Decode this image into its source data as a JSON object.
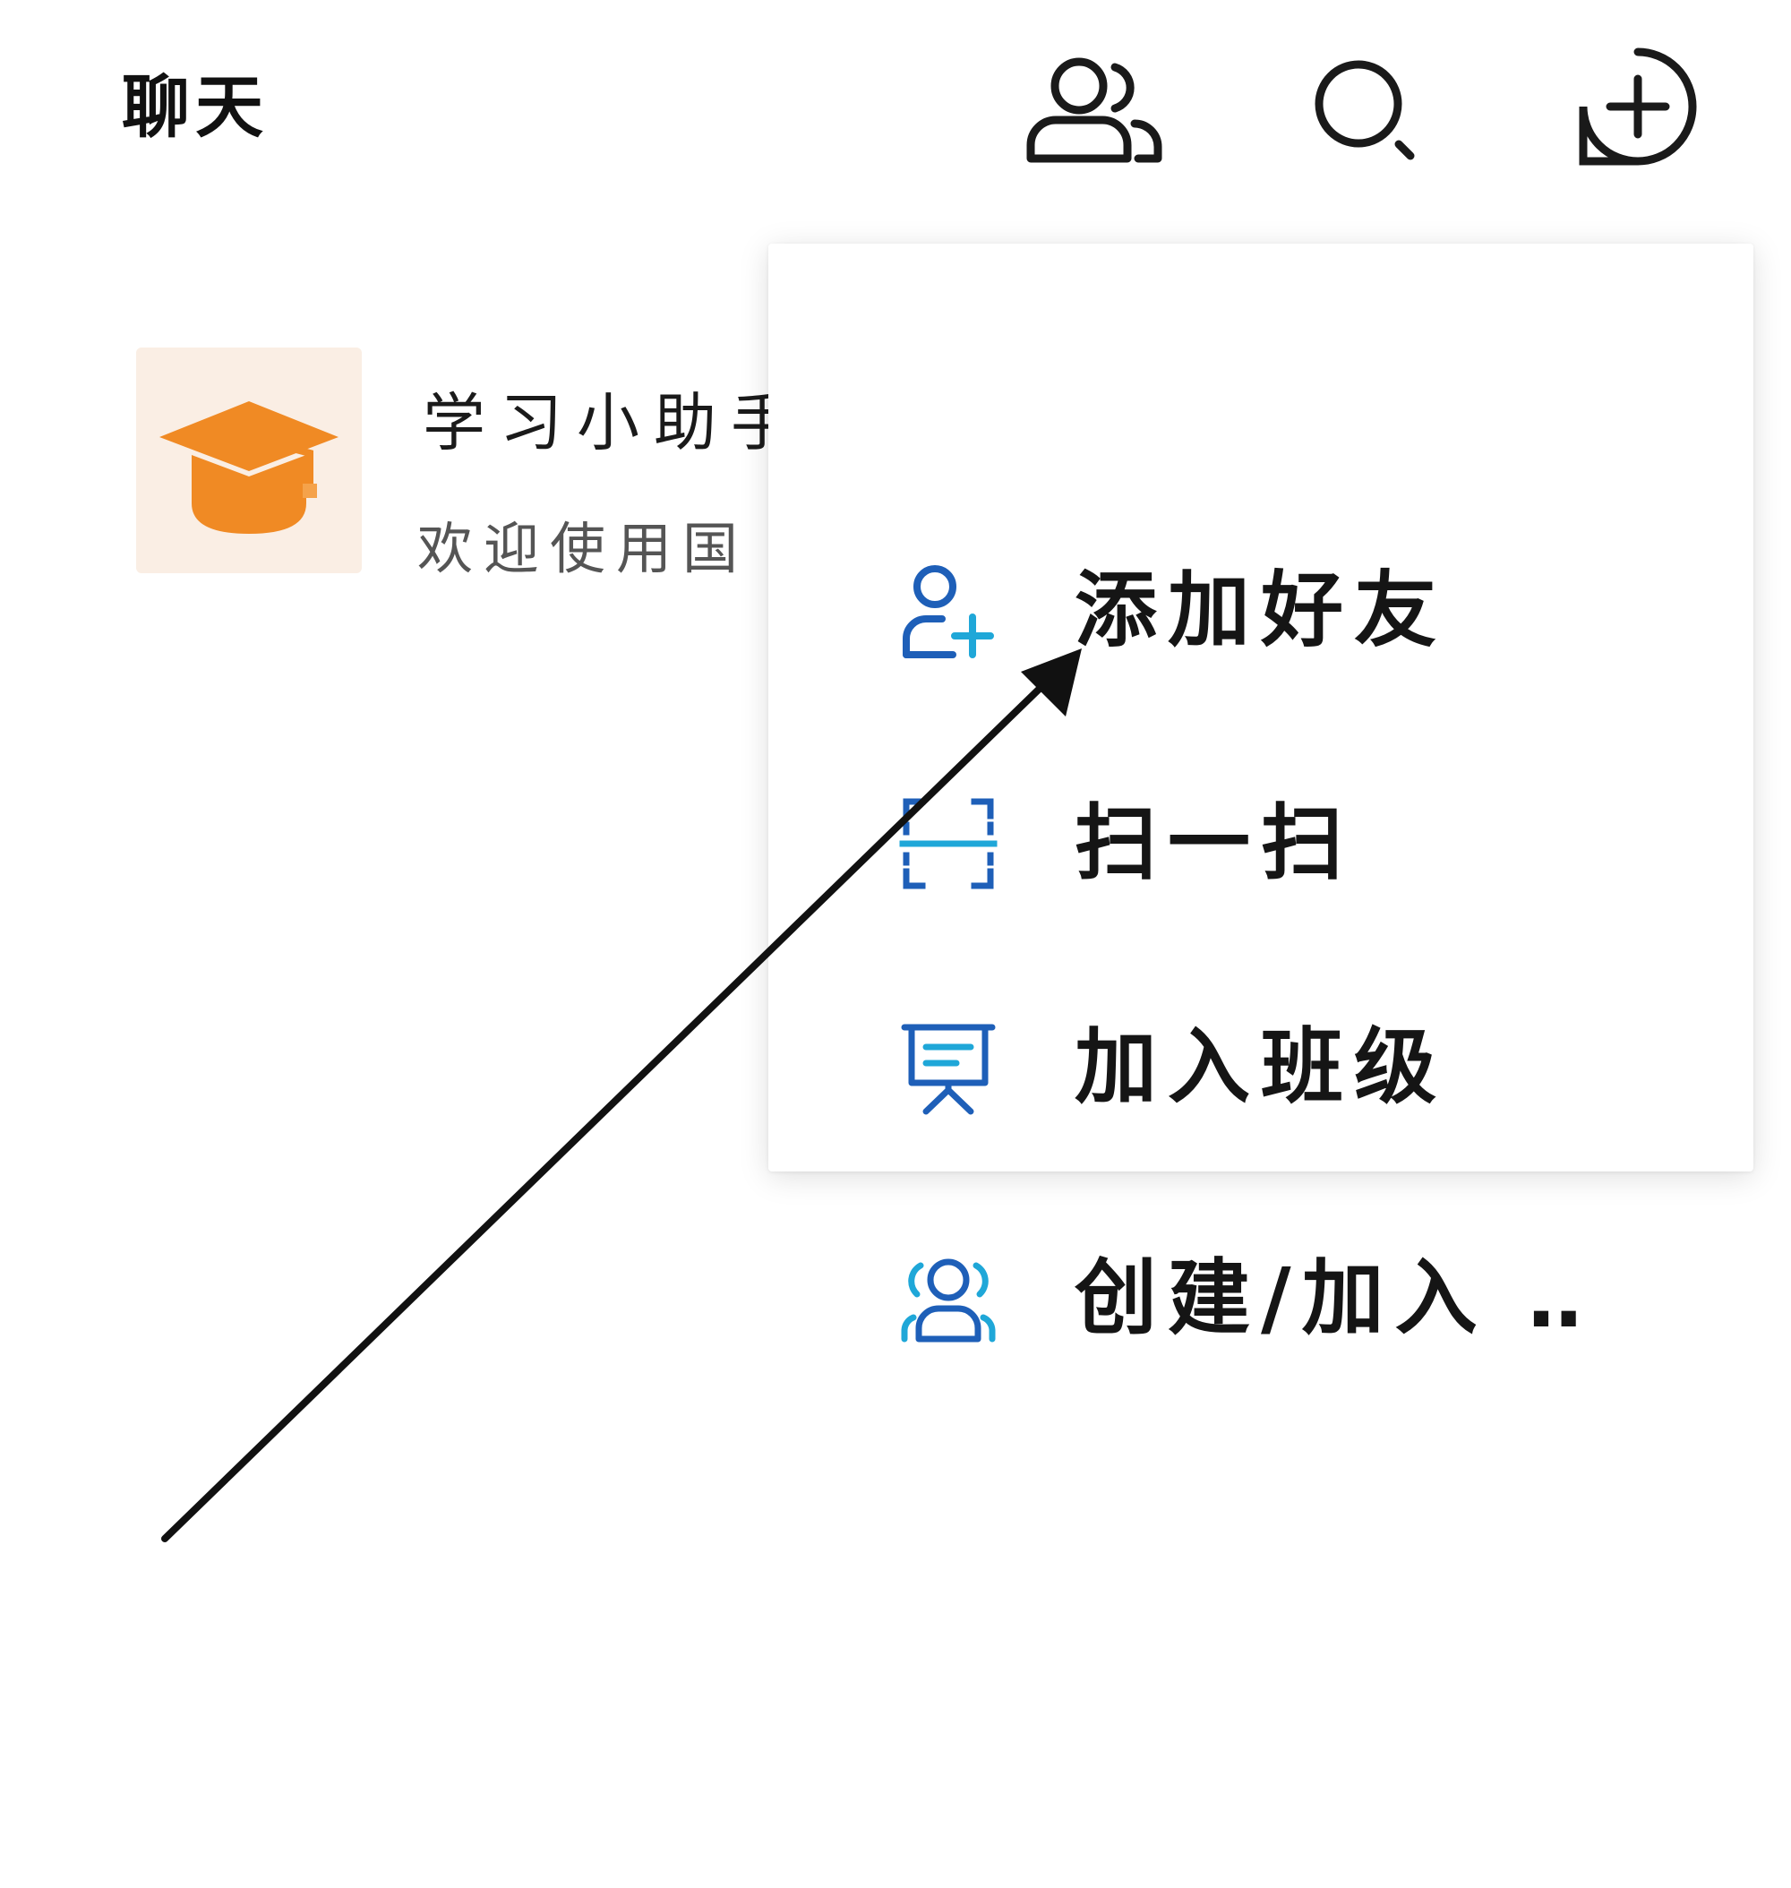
{
  "header": {
    "title": "聊天",
    "icons": [
      "contacts-icon",
      "search-icon",
      "add-icon"
    ]
  },
  "chat_list": [
    {
      "name": "学习小助手",
      "preview": "欢迎使用国",
      "avatar_icon": "graduation-cap-icon",
      "avatar_color": "#F08A24"
    }
  ],
  "menu": {
    "items": [
      {
        "label": "添加好友",
        "icon": "add-friend-icon"
      },
      {
        "label": "扫一扫",
        "icon": "scan-icon"
      },
      {
        "label": "加入班级",
        "icon": "join-class-icon"
      },
      {
        "label": "创建/加入 ‥",
        "icon": "group-icon"
      }
    ]
  },
  "colors": {
    "menu_icon_blue": "#1E5FB8",
    "menu_icon_cyan": "#1FA7D8",
    "avatar_bg": "#FAEEE4",
    "arrow": "#111111"
  }
}
